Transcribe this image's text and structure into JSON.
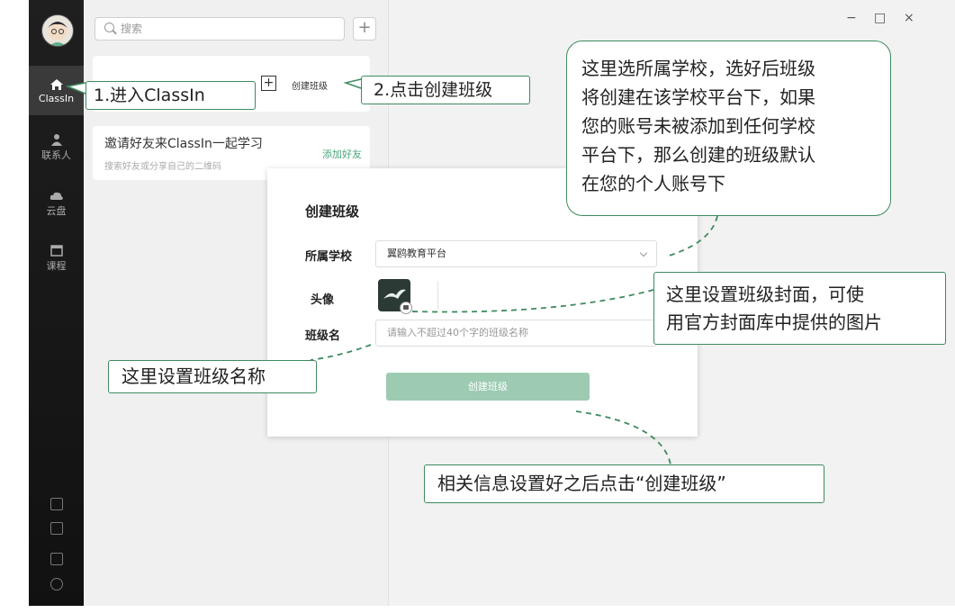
{
  "sidebar": {
    "items": [
      {
        "label": "ClassIn",
        "icon": "home-icon"
      },
      {
        "label": "联系人",
        "icon": "contact-icon"
      },
      {
        "label": "云盘",
        "icon": "cloud-icon"
      },
      {
        "label": "课程",
        "icon": "calendar-icon"
      }
    ]
  },
  "search": {
    "placeholder": "搜索"
  },
  "list": {
    "create_class_label": "创建班级",
    "invite_title": "邀请好友来ClassIn一起学习",
    "invite_subtitle": "搜索好友或分享自己的二维码",
    "add_friend_label": "添加好友"
  },
  "window_controls": {
    "minimize": "−",
    "maximize": "□",
    "close": "×"
  },
  "dialog": {
    "title": "创建班级",
    "school_label": "所属学校",
    "school_value": "翼鸥教育平台",
    "avatar_label": "头像",
    "class_name_label": "班级名",
    "class_name_placeholder": "请输入不超过40个字的班级名称",
    "create_button": "创建班级"
  },
  "callouts": {
    "step1": "1.进入ClassIn",
    "step2": "2.点击创建班级",
    "school_lines": [
      "这里选所属学校，选好后班级",
      "将创建在该学校平台下，如果",
      "您的账号未被添加到任何学校",
      "平台下，那么创建的班级默认",
      "在您的个人账号下"
    ],
    "cover_lines": [
      "这里设置班级封面，可使",
      "用官方封面库中提供的图片"
    ],
    "name": "这里设置班级名称",
    "submit": "相关信息设置好之后点击“创建班级”"
  },
  "colors": {
    "accent": "#3e8b5f",
    "button": "#9ccbb2",
    "rail": "#1a1a1a"
  }
}
